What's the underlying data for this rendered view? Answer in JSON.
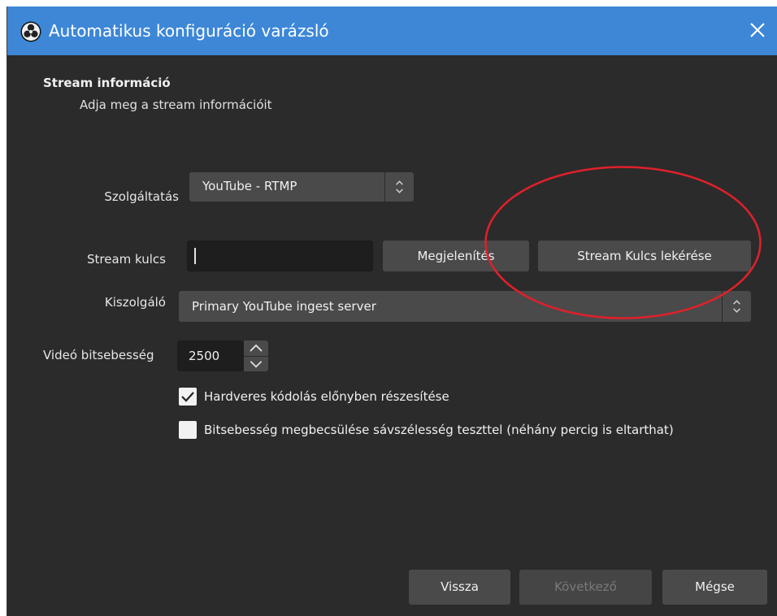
{
  "window": {
    "title": "Automatikus konfiguráció varázsló"
  },
  "header": {
    "title": "Stream információ",
    "subtitle": "Adja meg a stream információit"
  },
  "service": {
    "label": "Szolgáltatás",
    "value": "YouTube - RTMP"
  },
  "stream_key": {
    "label": "Stream kulcs",
    "value": "",
    "show_button": "Megjelenítés",
    "get_key_button": "Stream Kulcs lekérése"
  },
  "server": {
    "label": "Kiszolgáló",
    "value": "Primary YouTube ingest server"
  },
  "bitrate": {
    "label": "Videó bitsebesség",
    "value": "2500"
  },
  "options": {
    "hw_encoding": {
      "label": "Hardveres kódolás előnyben részesítése",
      "checked": true
    },
    "bandwidth_test": {
      "label": "Bitsebesség megbecsülése sávszélesség teszttel (néhány percig is eltarthat)",
      "checked": false
    }
  },
  "footer": {
    "back": "Vissza",
    "next": "Következő",
    "cancel": "Mégse"
  },
  "colors": {
    "titlebar": "#3d87d6",
    "background": "#2b2b2b",
    "control": "#4a4a4a",
    "input": "#1e1e1e",
    "annotation": "#e0202a"
  },
  "icons": {
    "app": "obs-logo-icon",
    "close": "close-icon"
  }
}
